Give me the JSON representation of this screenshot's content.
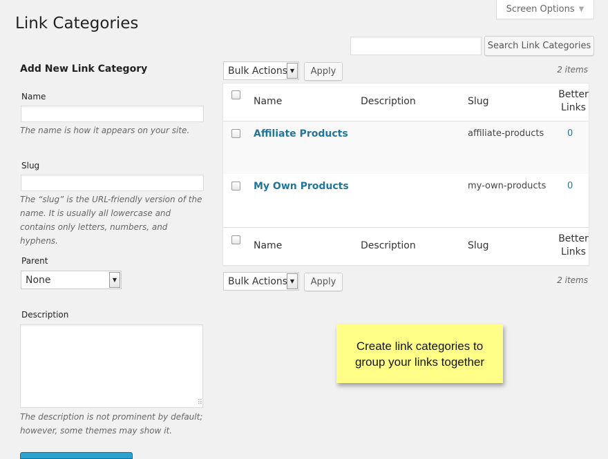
{
  "page": {
    "title": "Link Categories"
  },
  "screen_options": {
    "label": "Screen Options",
    "icon": "caret-down-icon"
  },
  "search": {
    "placeholder": "",
    "value": "",
    "button_label": "Search Link Categories"
  },
  "form": {
    "heading": "Add New Link Category",
    "name": {
      "label": "Name",
      "value": "",
      "help": "The name is how it appears on your site."
    },
    "slug": {
      "label": "Slug",
      "value": "",
      "help": "The “slug” is the URL-friendly version of the name. It is usually all lowercase and contains only letters, numbers, and hyphens."
    },
    "parent": {
      "label": "Parent",
      "selected": "None"
    },
    "description": {
      "label": "Description",
      "value": "",
      "help": "The description is not prominent by default; however, some themes may show it."
    }
  },
  "bulk": {
    "top": {
      "selected": "Bulk Actions",
      "apply_label": "Apply",
      "items_count": "2 items"
    },
    "bottom": {
      "selected": "Bulk Actions",
      "apply_label": "Apply",
      "items_count": "2 items"
    }
  },
  "table": {
    "columns": {
      "name": "Name",
      "description": "Description",
      "slug": "Slug",
      "links_line1": "Better",
      "links_line2": "Links"
    },
    "rows": [
      {
        "name": "Affiliate Products",
        "description": "",
        "slug": "affiliate-products",
        "count": "0"
      },
      {
        "name": "My Own Products",
        "description": "",
        "slug": "my-own-products",
        "count": "0"
      }
    ]
  },
  "note": {
    "line1": "Create link categories to",
    "line2": "group your links together"
  },
  "colors": {
    "link": "#21759b",
    "note_bg": "#ffff88",
    "primary_button": "#2ea2cc"
  }
}
